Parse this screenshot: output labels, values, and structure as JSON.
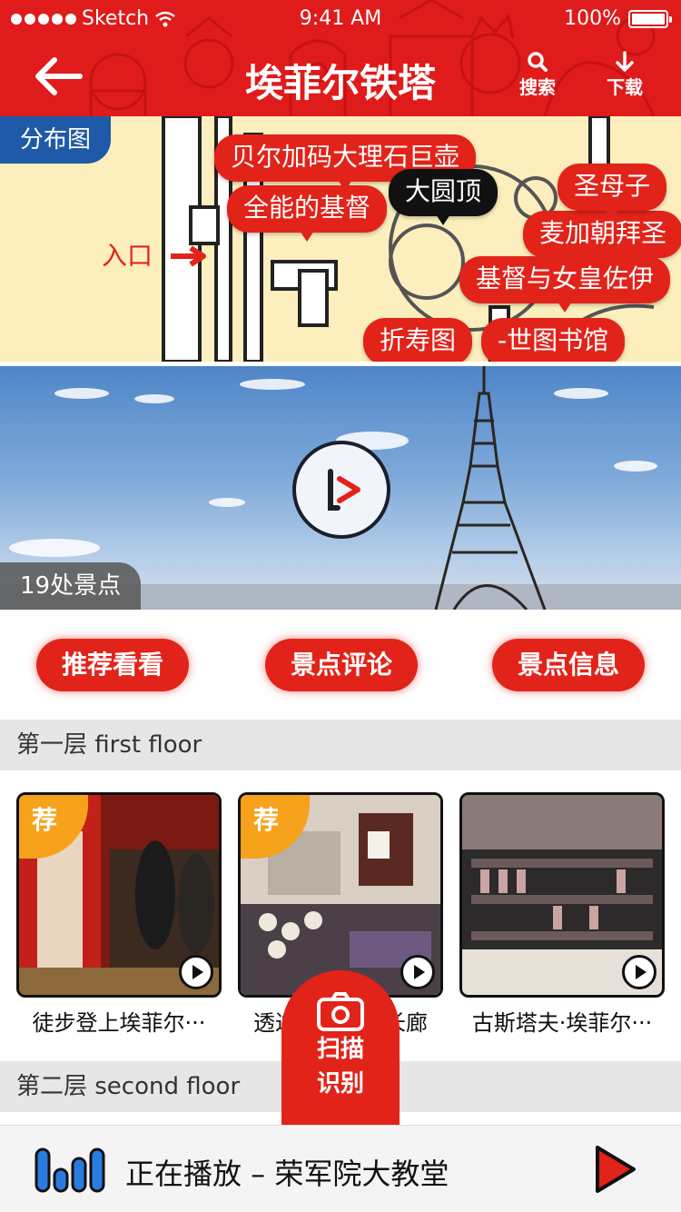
{
  "status_bar": {
    "carrier": "Sketch",
    "time": "9:41 AM",
    "battery": "100%"
  },
  "header": {
    "title": "埃菲尔铁塔",
    "search_label": "搜索",
    "download_label": "下载"
  },
  "map": {
    "tag": "分布图",
    "entrance": "入口",
    "pins": [
      "贝尔加码大理石巨壶",
      "全能的基督",
      "大圆顶",
      "圣母子",
      "麦加朝拜圣",
      "基督与女皇佐伊",
      "折寿图",
      "-世图书馆"
    ]
  },
  "hero": {
    "spots_count": "19处景点"
  },
  "actions": {
    "recommend": "推荐看看",
    "comments": "景点评论",
    "info": "景点信息"
  },
  "floors": [
    {
      "label": "第一层 first floor",
      "items": [
        {
          "title": "徒步登上埃菲尔···",
          "badge": "荐"
        },
        {
          "title": "透过玻璃欣赏长廊",
          "badge": "荐"
        },
        {
          "title": "古斯塔夫·埃菲尔···",
          "badge": ""
        }
      ]
    },
    {
      "label": "第二层 second floor"
    }
  ],
  "scan": {
    "line1": "扫描",
    "line2": "识别"
  },
  "player": {
    "now_playing": "正在播放 – 荣军院大教堂"
  },
  "colors": {
    "primary": "#e01b1b",
    "map_tag": "#1f5aa8",
    "badge": "#f7a21b",
    "map_bg": "#fcefbd"
  }
}
